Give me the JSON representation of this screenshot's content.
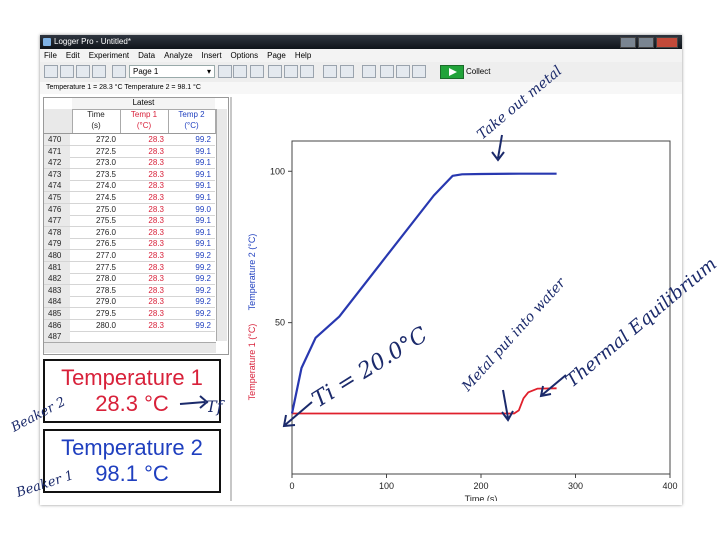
{
  "window": {
    "title": "Logger Pro - Untitled*"
  },
  "menu": [
    "File",
    "Edit",
    "Experiment",
    "Data",
    "Analyze",
    "Insert",
    "Options",
    "Page",
    "Help"
  ],
  "toolbar": {
    "page_label": "Page 1",
    "collect_label": "Collect"
  },
  "status": {
    "text": "Temperature 1 = 28.3 °C  Temperature 2 = 98.1 °C"
  },
  "table": {
    "group_header": "Latest",
    "columns": [
      "Time\n(s)",
      "Temp 1\n(°C)",
      "Temp 2\n(°C)"
    ],
    "rows": [
      [
        "470",
        "272.0",
        "28.3",
        "99.2"
      ],
      [
        "471",
        "272.5",
        "28.3",
        "99.1"
      ],
      [
        "472",
        "273.0",
        "28.3",
        "99.1"
      ],
      [
        "473",
        "273.5",
        "28.3",
        "99.1"
      ],
      [
        "474",
        "274.0",
        "28.3",
        "99.1"
      ],
      [
        "475",
        "274.5",
        "28.3",
        "99.1"
      ],
      [
        "476",
        "275.0",
        "28.3",
        "99.0"
      ],
      [
        "477",
        "275.5",
        "28.3",
        "99.1"
      ],
      [
        "478",
        "276.0",
        "28.3",
        "99.1"
      ],
      [
        "479",
        "276.5",
        "28.3",
        "99.1"
      ],
      [
        "480",
        "277.0",
        "28.3",
        "99.2"
      ],
      [
        "481",
        "277.5",
        "28.3",
        "99.2"
      ],
      [
        "482",
        "278.0",
        "28.3",
        "99.2"
      ],
      [
        "483",
        "278.5",
        "28.3",
        "99.2"
      ],
      [
        "484",
        "279.0",
        "28.3",
        "99.2"
      ],
      [
        "485",
        "279.5",
        "28.3",
        "99.2"
      ],
      [
        "486",
        "280.0",
        "28.3",
        "99.2"
      ],
      [
        "487",
        "",
        "",
        ""
      ]
    ]
  },
  "meters": [
    {
      "label": "Temperature 1",
      "value": "28.3 °C",
      "color": "#d8213a"
    },
    {
      "label": "Temperature 2",
      "value": "98.1 °C",
      "color": "#1f3fbf"
    }
  ],
  "annotations": {
    "beaker2": "Beaker 2",
    "beaker1": "Beaker 1",
    "tf": "Tf",
    "ti": "Ti = 20.0°C",
    "take_out": "Take out metal",
    "metal_put": "Metal put into water",
    "thermal": "Thermal Equilibrium"
  },
  "chart_data": {
    "type": "line",
    "xlabel": "Time (s)",
    "ylabel_1": "Temperature 1 (°C)",
    "ylabel_2": "Temperature 2 (°C)",
    "xlim": [
      0,
      400
    ],
    "ylim": [
      0,
      110
    ],
    "xticks": [
      0,
      100,
      200,
      300,
      400
    ],
    "yticks": [
      50,
      100
    ],
    "series": [
      {
        "name": "Temperature 1",
        "color": "#e0202c",
        "x": [
          0,
          100,
          200,
          235,
          240,
          245,
          250,
          260,
          280
        ],
        "y": [
          20,
          20,
          20,
          20,
          21,
          25,
          27,
          28.2,
          28.3
        ]
      },
      {
        "name": "Temperature 2",
        "color": "#2838b0",
        "x": [
          0,
          10,
          25,
          50,
          100,
          150,
          170,
          180,
          200,
          240,
          280
        ],
        "y": [
          20,
          35,
          45,
          52,
          72,
          92,
          98.5,
          99,
          99.1,
          99.2,
          99.2
        ]
      }
    ]
  }
}
